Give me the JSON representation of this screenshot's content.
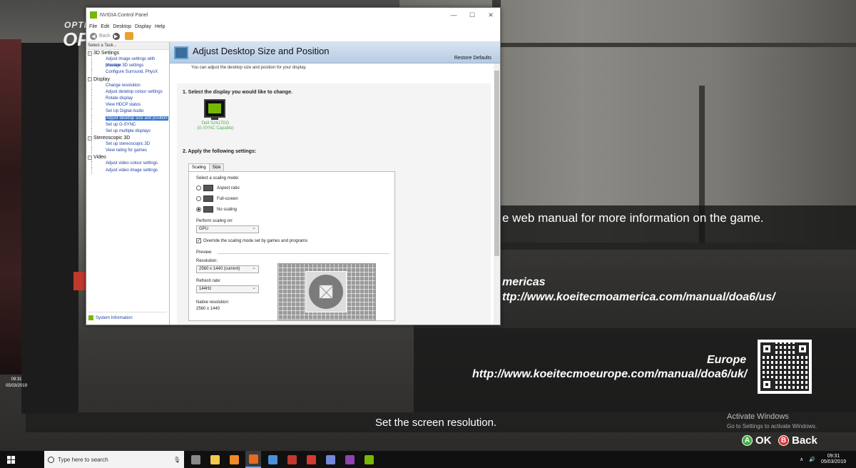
{
  "game": {
    "options_title": "OPTIO",
    "options_big": "OP",
    "manual_text": "e web manual for more information on the game.",
    "americas_label": "mericas",
    "americas_url": "ttp://www.koeitecmoamerica.com/manual/doa6/us/",
    "europe_label": "Europe",
    "europe_url": "http://www.koeitecmoeurope.com/manual/doa6/uk/",
    "hint": "Set the screen resolution.",
    "activate_title": "Activate Windows",
    "activate_sub": "Go to Settings to activate Windows.",
    "ok_glyph": "A",
    "ok_label": "OK",
    "back_glyph": "B",
    "back_label": "Back",
    "side_time": "09:31",
    "side_date": "05/03/2019",
    "colors": {
      "accent_ok": "#3fae3f",
      "accent_back": "#d93a3a"
    }
  },
  "window": {
    "title": "NVIDIA Control Panel",
    "controls": {
      "minimize": "—",
      "maximize": "☐",
      "close": "✕"
    },
    "menu": [
      "File",
      "Edit",
      "Desktop",
      "Display",
      "Help"
    ],
    "toolbar": {
      "back": "Back",
      "back_glyph": "◀",
      "forward_glyph": "▶"
    },
    "sidebar": {
      "header": "Select a Task...",
      "categories": [
        {
          "label": "3D Settings",
          "items": [
            "Adjust image settings with preview",
            "Manage 3D settings",
            "Configure Surround, PhysX"
          ]
        },
        {
          "label": "Display",
          "items": [
            "Change resolution",
            "Adjust desktop colour settings",
            "Rotate display",
            "View HDCP status",
            "Set Up Digital Audio",
            "Adjust desktop size and position",
            "Set up G-SYNC",
            "Set up multiple displays"
          ]
        },
        {
          "label": "Stereoscopic 3D",
          "items": [
            "Set up stereoscopic 3D",
            "View rating for games"
          ]
        },
        {
          "label": "Video",
          "items": [
            "Adjust video colour settings",
            "Adjust video image settings"
          ]
        }
      ],
      "expand_glyph": "−",
      "system_info": "System Information"
    },
    "content": {
      "title": "Adjust Desktop Size and Position",
      "restore": "Restore Defaults",
      "description": "You can adjust the desktop size and position for your display.",
      "step1": "1. Select the display you would like to change.",
      "display_name": "Dell S2417DG",
      "display_sub": "(G-SYNC Capable)",
      "step2": "2. Apply the following settings:",
      "tabs": [
        "Scaling",
        "Size"
      ],
      "scaling_mode_label": "Select a scaling mode:",
      "modes": [
        "Aspect ratio",
        "Full-screen",
        "No scaling"
      ],
      "perform_label": "Perform scaling on:",
      "perform_value": "GPU",
      "override": "Override the scaling mode set by games and programs",
      "check_glyph": "✓",
      "preview_label": "Preview",
      "resolution_label": "Resolution:",
      "resolution_value": "2560 x 1440 (current)",
      "refresh_label": "Refresh rate:",
      "refresh_value": "144Hz",
      "native_label": "Native resolution:",
      "native_value": "2560 x 1440"
    }
  },
  "taskbar": {
    "search_placeholder": "Type here to search",
    "mic_glyph": "🎙",
    "tray_caret": "∧",
    "volume_glyph": "🔊",
    "time": "09:31",
    "date": "05/03/2019",
    "apps": [
      {
        "name": "task-view",
        "color": "#888888"
      },
      {
        "name": "file-explorer",
        "color": "#f2c94c"
      },
      {
        "name": "vlc",
        "color": "#f08a24"
      },
      {
        "name": "firefox",
        "color": "#e66a1f"
      },
      {
        "name": "network-app",
        "color": "#4a90d9"
      },
      {
        "name": "msi-afterburner",
        "color": "#c0392b"
      },
      {
        "name": "gaming-app",
        "color": "#d63a2f"
      },
      {
        "name": "discord",
        "color": "#7289da"
      },
      {
        "name": "onenote",
        "color": "#8e44ad"
      },
      {
        "name": "nvidia",
        "color": "#76b900"
      }
    ]
  }
}
